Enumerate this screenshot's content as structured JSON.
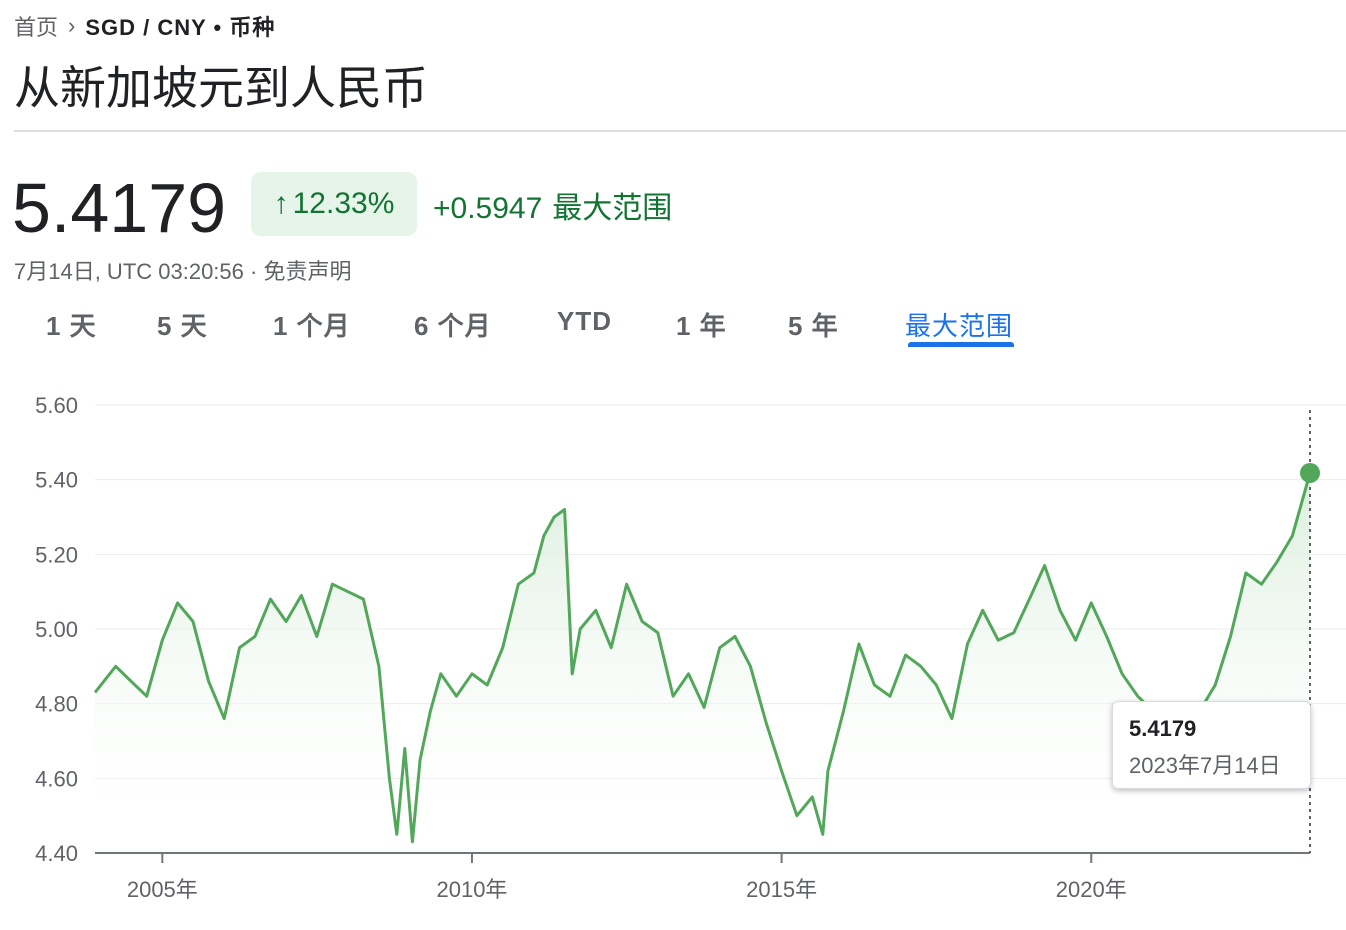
{
  "breadcrumb": {
    "home": "首页",
    "current": "SGD / CNY • 币种"
  },
  "title": "从新加坡元到人民币",
  "quote": {
    "price": "5.4179",
    "percent_change": "12.33%",
    "abs_change": "+0.5947",
    "range_label": "最大范围",
    "timestamp": "7月14日, UTC 03:20:56 · 免责声明"
  },
  "tabs": [
    {
      "label": "1 天",
      "active": false
    },
    {
      "label": "5 天",
      "active": false
    },
    {
      "label": "1 个月",
      "active": false
    },
    {
      "label": "6 个月",
      "active": false
    },
    {
      "label": "YTD",
      "active": false
    },
    {
      "label": "1 年",
      "active": false
    },
    {
      "label": "5 年",
      "active": false
    },
    {
      "label": "最大范围",
      "active": true
    }
  ],
  "tooltip": {
    "value": "5.4179",
    "date": "2023年7月14日"
  },
  "colors": {
    "line": "#52a75a",
    "fill_top": "#d7ecd9",
    "positive_text": "#137333",
    "chip_bg": "#e6f4ea",
    "accent": "#1a73e8"
  },
  "chart_data": {
    "type": "area",
    "title": "",
    "xlabel": "",
    "ylabel": "",
    "ylim": [
      4.4,
      5.6
    ],
    "y_ticks": [
      "5.60",
      "5.40",
      "5.20",
      "5.00",
      "4.80",
      "4.60",
      "4.40"
    ],
    "x_ticks": [
      "2005年",
      "2010年",
      "2015年",
      "2020年"
    ],
    "grid": true,
    "highlight": {
      "date": "2023-07-14",
      "value": 5.4179
    },
    "series": [
      {
        "x": [
          "2003-12-01",
          "2004-04-01",
          "2004-07-01",
          "2004-10-01",
          "2005-01-01",
          "2005-04-01",
          "2005-07-01",
          "2005-10-01",
          "2006-01-01",
          "2006-04-01",
          "2006-07-01",
          "2006-10-01",
          "2007-01-01",
          "2007-04-01",
          "2007-07-01",
          "2007-10-01",
          "2008-01-01",
          "2008-04-01",
          "2008-07-01",
          "2008-09-01",
          "2008-10-15",
          "2008-12-01",
          "2009-01-15",
          "2009-03-01",
          "2009-05-01",
          "2009-07-01",
          "2009-10-01",
          "2010-01-01",
          "2010-04-01",
          "2010-07-01",
          "2010-10-01",
          "2011-01-01",
          "2011-03-01",
          "2011-05-01",
          "2011-07-01",
          "2011-08-15",
          "2011-10-01",
          "2012-01-01",
          "2012-04-01",
          "2012-07-01",
          "2012-10-01",
          "2013-01-01",
          "2013-04-01",
          "2013-07-01",
          "2013-10-01",
          "2014-01-01",
          "2014-04-01",
          "2014-07-01",
          "2014-10-01",
          "2015-01-01",
          "2015-04-01",
          "2015-07-01",
          "2015-09-01",
          "2015-10-01",
          "2016-01-01",
          "2016-04-01",
          "2016-07-01",
          "2016-10-01",
          "2017-01-01",
          "2017-04-01",
          "2017-07-01",
          "2017-10-01",
          "2018-01-01",
          "2018-04-01",
          "2018-07-01",
          "2018-10-01",
          "2019-01-01",
          "2019-04-01",
          "2019-07-01",
          "2019-10-01",
          "2020-01-01",
          "2020-04-01",
          "2020-07-01",
          "2020-10-01",
          "2021-01-01",
          "2021-04-01",
          "2021-07-01",
          "2021-10-01",
          "2022-01-01",
          "2022-04-01",
          "2022-07-01",
          "2022-10-01",
          "2023-01-01",
          "2023-04-01",
          "2023-07-14"
        ],
        "values": [
          4.83,
          4.9,
          4.86,
          4.82,
          4.97,
          5.07,
          5.02,
          4.86,
          4.76,
          4.95,
          4.98,
          5.08,
          5.02,
          5.09,
          4.98,
          5.12,
          5.1,
          5.08,
          4.9,
          4.6,
          4.45,
          4.68,
          4.43,
          4.65,
          4.78,
          4.88,
          4.82,
          4.88,
          4.85,
          4.95,
          5.12,
          5.15,
          5.25,
          5.3,
          5.32,
          4.88,
          5.0,
          5.05,
          4.95,
          5.12,
          5.02,
          4.99,
          4.82,
          4.88,
          4.79,
          4.95,
          4.98,
          4.9,
          4.75,
          4.62,
          4.5,
          4.55,
          4.45,
          4.62,
          4.78,
          4.96,
          4.85,
          4.82,
          4.93,
          4.9,
          4.85,
          4.76,
          4.96,
          5.05,
          4.97,
          4.99,
          5.08,
          5.17,
          5.05,
          4.97,
          5.07,
          4.98,
          4.88,
          4.82,
          4.78,
          4.8,
          4.75,
          4.78,
          4.85,
          4.98,
          5.15,
          5.12,
          5.18,
          5.25,
          5.4179
        ]
      }
    ]
  }
}
